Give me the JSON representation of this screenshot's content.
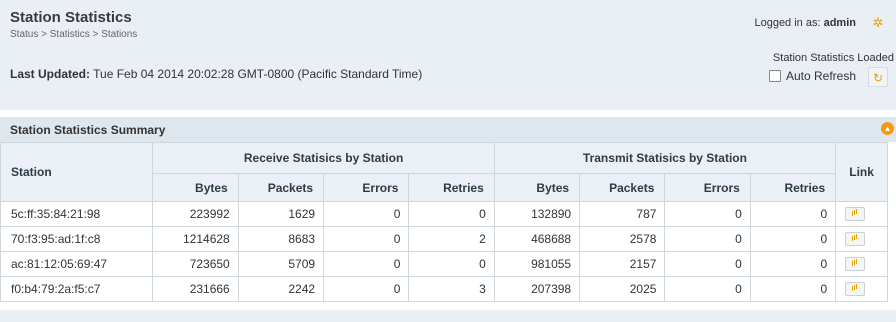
{
  "header": {
    "title": "Station Statistics",
    "breadcrumb": "Status > Statistics > Stations",
    "last_updated_label": "Last Updated:",
    "last_updated_value": "Tue Feb 04 2014 20:02:28 GMT-0800 (Pacific Standard Time)",
    "logged_in_label": "Logged in as:",
    "logged_in_user": "admin",
    "status_text": "Station Statistics Loaded",
    "auto_refresh_label": "Auto Refresh",
    "auto_refresh_checked": false
  },
  "summary": {
    "title": "Station Statistics Summary"
  },
  "table": {
    "station_header": "Station",
    "receive_group": "Receive Statisics by Station",
    "transmit_group": "Transmit Statisics by Station",
    "link_header": "Link",
    "subheaders": [
      "Bytes",
      "Packets",
      "Errors",
      "Retries"
    ],
    "rows": [
      {
        "station": "5c:ff:35:84:21:98",
        "rx_bytes": "223992",
        "rx_packets": "1629",
        "rx_errors": "0",
        "rx_retries": "0",
        "tx_bytes": "132890",
        "tx_packets": "787",
        "tx_errors": "0",
        "tx_retries": "0"
      },
      {
        "station": "70:f3:95:ad:1f:c8",
        "rx_bytes": "1214628",
        "rx_packets": "8683",
        "rx_errors": "0",
        "rx_retries": "2",
        "tx_bytes": "468688",
        "tx_packets": "2578",
        "tx_errors": "0",
        "tx_retries": "0"
      },
      {
        "station": "ac:81:12:05:69:47",
        "rx_bytes": "723650",
        "rx_packets": "5709",
        "rx_errors": "0",
        "rx_retries": "0",
        "tx_bytes": "981055",
        "tx_packets": "2157",
        "tx_errors": "0",
        "tx_retries": "0"
      },
      {
        "station": "f0:b4:79:2a:f5:c7",
        "rx_bytes": "231666",
        "rx_packets": "2242",
        "rx_errors": "0",
        "rx_retries": "3",
        "tx_bytes": "207398",
        "tx_packets": "2025",
        "tx_errors": "0",
        "tx_retries": "0"
      }
    ]
  },
  "icons": {
    "gear": "gear-icon",
    "refresh": "refresh-icon",
    "collapse": "chevron-up-icon",
    "link": "chart-icon"
  },
  "colors": {
    "accent": "#e8a200",
    "header_bg": "#e9eff4",
    "summary_bg": "#dfe7ee"
  }
}
